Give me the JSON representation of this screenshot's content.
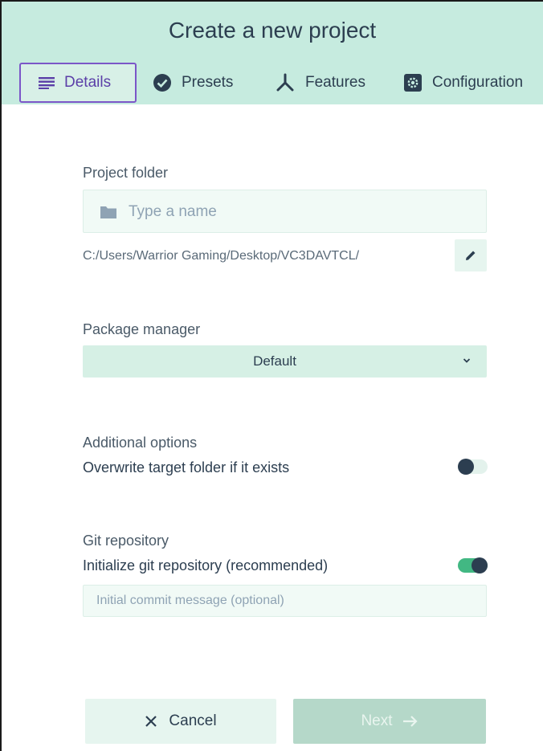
{
  "header": {
    "title": "Create a new project",
    "tabs": [
      {
        "label": "Details",
        "icon": "list-icon",
        "active": true
      },
      {
        "label": "Presets",
        "icon": "check-circle-icon"
      },
      {
        "label": "Features",
        "icon": "merge-icon"
      },
      {
        "label": "Configuration",
        "icon": "gear-icon"
      }
    ]
  },
  "form": {
    "project_folder": {
      "label": "Project folder",
      "placeholder": "Type a name",
      "path": "C:/Users/Warrior Gaming/Desktop/VC3DAVTCL/"
    },
    "package_manager": {
      "label": "Package manager",
      "selected": "Default"
    },
    "additional_options": {
      "label": "Additional options",
      "overwrite_label": "Overwrite target folder if it exists",
      "overwrite_enabled": false
    },
    "git": {
      "label": "Git repository",
      "init_label": "Initialize git repository (recommended)",
      "init_enabled": true,
      "commit_placeholder": "Initial commit message (optional)"
    }
  },
  "actions": {
    "cancel_label": "Cancel",
    "next_label": "Next"
  },
  "colors": {
    "header_bg": "#c6ebdf",
    "accent": "#42b883",
    "active_tab": "#7b56c8",
    "text": "#2c3e50"
  }
}
